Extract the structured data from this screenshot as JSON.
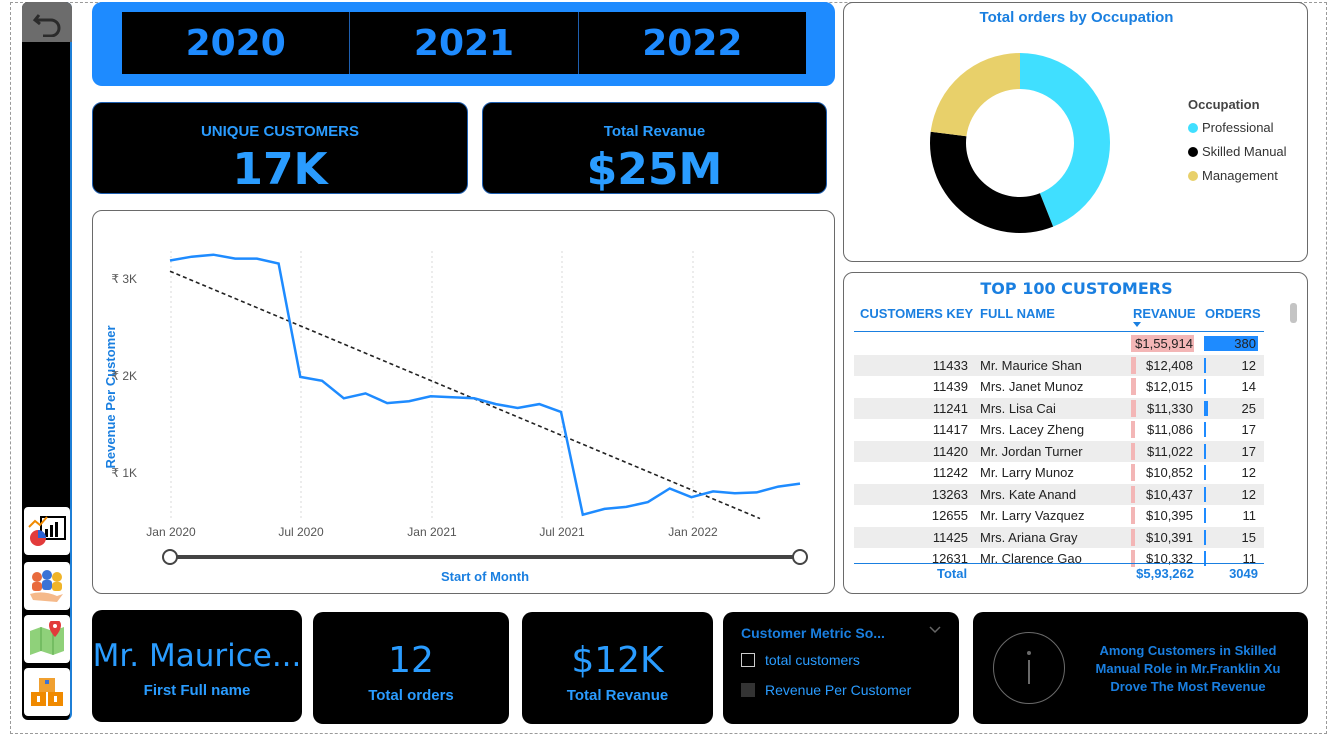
{
  "years": [
    "2020",
    "2021",
    "2022"
  ],
  "kpis": {
    "unique_customers": {
      "label": "UNIQUE CUSTOMERS",
      "value": "17K"
    },
    "total_revenue": {
      "label": "Total Revanue",
      "value": "$25M"
    }
  },
  "line_chart": {
    "ylabel": "Revenue Per Customer",
    "xlabel": "Start of Month",
    "y_ticks": [
      "₹ 3K",
      "₹ 2K",
      "₹ 1K"
    ],
    "x_ticks": [
      "Jan 2020",
      "Jul 2020",
      "Jan 2021",
      "Jul 2021",
      "Jan 2022"
    ]
  },
  "chart_data": [
    {
      "type": "line",
      "title": "",
      "xlabel": "Start of Month",
      "ylabel": "Revenue Per Customer",
      "ylim": [
        500,
        3300
      ],
      "series": [
        {
          "values": [
            3180,
            3220,
            3240,
            3200,
            3200,
            3150,
            1980,
            1940,
            1760,
            1810,
            1710,
            1730,
            1780,
            1770,
            1760,
            1700,
            1660,
            1700,
            1620,
            560,
            620,
            640,
            690,
            830,
            740,
            800,
            780,
            790,
            850,
            880
          ]
        }
      ],
      "trend": {
        "start": 3070,
        "end": 520
      },
      "grid": true
    },
    {
      "type": "pie",
      "title": "Total orders by Occupation",
      "legend_title": "Occupation",
      "categories": [
        "Professional",
        "Skilled Manual",
        "Management"
      ],
      "values": [
        44,
        33,
        23
      ],
      "colors": [
        "#40dfff",
        "#000000",
        "#e8d06a"
      ]
    }
  ],
  "occupation": {
    "title": "Total orders by Occupation",
    "legend_title": "Occupation",
    "items": [
      {
        "label": "Professional",
        "color": "#40dfff"
      },
      {
        "label": "Skilled Manual",
        "color": "#000000"
      },
      {
        "label": "Management",
        "color": "#e8d06a"
      }
    ]
  },
  "top100": {
    "title": "TOP 100 CUSTOMERS",
    "headers": [
      "CUSTOMERS KEY",
      "FULL NAME",
      "REVANUE",
      "ORDERS"
    ],
    "first_row": {
      "revenue": "$1,55,914",
      "orders": "380"
    },
    "rows": [
      {
        "key": "11433",
        "name": "Mr. Maurice Shan",
        "revenue": "$12,408",
        "orders": "12"
      },
      {
        "key": "11439",
        "name": "Mrs. Janet Munoz",
        "revenue": "$12,015",
        "orders": "14"
      },
      {
        "key": "11241",
        "name": "Mrs. Lisa Cai",
        "revenue": "$11,330",
        "orders": "25"
      },
      {
        "key": "11417",
        "name": "Mrs. Lacey Zheng",
        "revenue": "$11,086",
        "orders": "17"
      },
      {
        "key": "11420",
        "name": "Mr. Jordan Turner",
        "revenue": "$11,022",
        "orders": "17"
      },
      {
        "key": "11242",
        "name": "Mr. Larry Munoz",
        "revenue": "$10,852",
        "orders": "12"
      },
      {
        "key": "13263",
        "name": "Mrs. Kate Anand",
        "revenue": "$10,437",
        "orders": "12"
      },
      {
        "key": "12655",
        "name": "Mr. Larry Vazquez",
        "revenue": "$10,395",
        "orders": "11"
      },
      {
        "key": "11425",
        "name": "Mrs. Ariana Gray",
        "revenue": "$10,391",
        "orders": "15"
      },
      {
        "key": "12631",
        "name": "Mr. Clarence Gao",
        "revenue": "$10,332",
        "orders": "11"
      }
    ],
    "total": {
      "label": "Total",
      "revenue": "$5,93,262",
      "orders": "3049"
    }
  },
  "bottom": {
    "first_name": {
      "value": "Mr. Maurice...",
      "label": "First Full name"
    },
    "orders": {
      "value": "12",
      "label": "Total orders"
    },
    "revenue": {
      "value": "$12K",
      "label": "Total Revanue"
    },
    "slicer": {
      "title": "Customer Metric So...",
      "options": [
        "total customers",
        "Revenue Per Customer"
      ]
    },
    "insight": "Among Customers in Skilled Manual Role in Mr.Franklin Xu Drove The Most Revenue"
  }
}
